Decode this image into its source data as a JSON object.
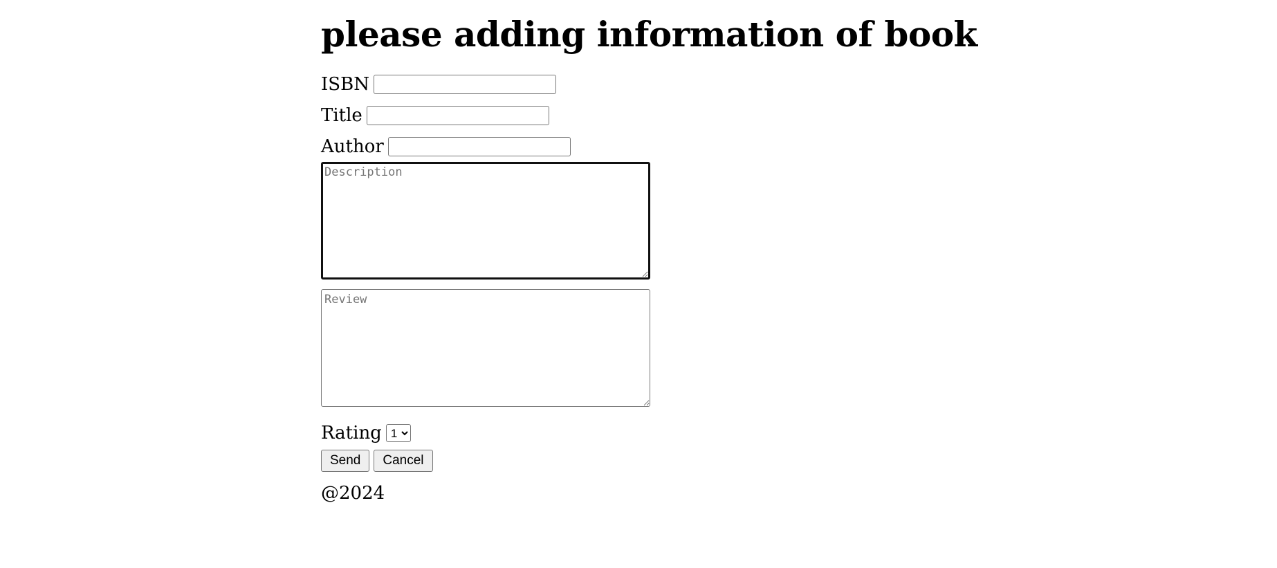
{
  "page": {
    "heading": "please adding information of book"
  },
  "form": {
    "isbn": {
      "label": "ISBN",
      "value": ""
    },
    "title": {
      "label": "Title",
      "value": ""
    },
    "author": {
      "label": "Author",
      "value": ""
    },
    "description": {
      "placeholder": "Description",
      "value": ""
    },
    "review": {
      "placeholder": "Review",
      "value": ""
    },
    "rating": {
      "label": "Rating",
      "selected": "1"
    },
    "send_label": "Send",
    "cancel_label": "Cancel"
  },
  "footer": {
    "text": "@2024"
  }
}
